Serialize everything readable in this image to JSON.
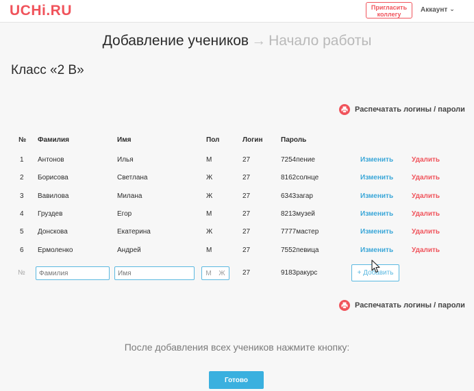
{
  "header": {
    "logo": "UCHi.RU",
    "invite_line1": "Пригласить",
    "invite_line2": "коллегу",
    "account": "Аккаунт"
  },
  "steps": {
    "current": "Добавление учеников",
    "next": "Начало работы"
  },
  "class_title": "Класс «2 В»",
  "print_label": "Распечатать логины / пароли",
  "table": {
    "headers": [
      "№",
      "Фамилия",
      "Имя",
      "Пол",
      "Логин",
      "Пароль"
    ],
    "edit_label": "Изменить",
    "delete_label": "Удалить",
    "rows": [
      {
        "num": "1",
        "surname": "Антонов",
        "name": "Илья",
        "gender": "М",
        "login": "27",
        "password": "7254пение"
      },
      {
        "num": "2",
        "surname": "Борисова",
        "name": "Светлана",
        "gender": "Ж",
        "login": "27",
        "password": "8162солнце"
      },
      {
        "num": "3",
        "surname": "Вавилова",
        "name": "Милана",
        "gender": "Ж",
        "login": "27",
        "password": "6343загар"
      },
      {
        "num": "4",
        "surname": "Груздев",
        "name": "Егор",
        "gender": "М",
        "login": "27",
        "password": "8213музей"
      },
      {
        "num": "5",
        "surname": "Донскова",
        "name": "Екатерина",
        "gender": "Ж",
        "login": "27",
        "password": "7777мастер"
      },
      {
        "num": "6",
        "surname": "Ермоленко",
        "name": "Андрей",
        "gender": "М",
        "login": "27",
        "password": "7552певица"
      }
    ]
  },
  "new_row": {
    "num": "№",
    "surname_placeholder": "Фамилия",
    "name_placeholder": "Имя",
    "gender_m": "М",
    "gender_f": "Ж",
    "login": "27",
    "password": "9183ракурс",
    "add_label": "+ Добавить"
  },
  "hint": "После добавления всех учеников нажмите кнопку:",
  "done_label": "Готово",
  "colors": {
    "accent_red": "#f0535b",
    "accent_blue": "#3ab0df"
  }
}
